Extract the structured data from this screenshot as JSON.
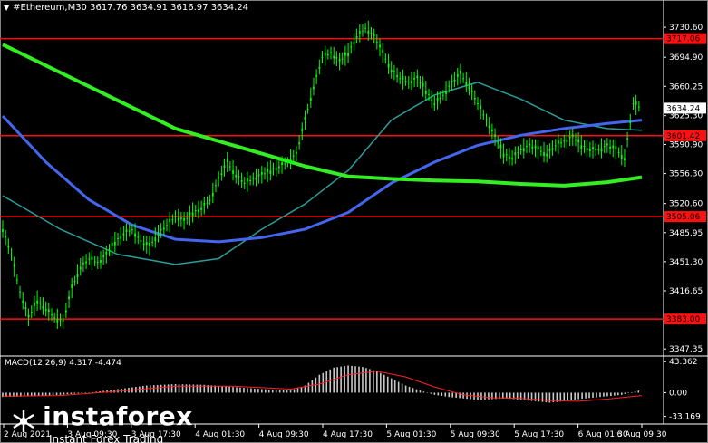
{
  "header": {
    "symbol_line": "#Ethereum,M30  3617.76 3634.91 3616.97 3634.24"
  },
  "macd": {
    "label": "MACD(12,26,9) 4.317 -4.474"
  },
  "logo": {
    "name": "instaforex",
    "tagline": "Instant Forex Trading"
  },
  "colors": {
    "background": "#000000",
    "candle": "#00ff00",
    "ma_fast": "#2a9d9a",
    "ma_mid": "#4466ee",
    "ma_slow": "#33ee22",
    "level_line": "#ff1010",
    "macd_hist": "#c8c8c8",
    "macd_signal": "#ff2020",
    "axis": "#ffffff"
  },
  "chart_data": {
    "type": "candlestick",
    "symbol": "#Ethereum",
    "timeframe": "M30",
    "ylim": [
      3340,
      3748
    ],
    "price_ticks": [
      "3730.60",
      "3694.90",
      "3660.25",
      "3625.30",
      "3590.90",
      "3556.30",
      "3520.60",
      "3485.95",
      "3451.30",
      "3416.65",
      "3381.00",
      "3347.35"
    ],
    "levels": [
      {
        "value": "3717.06"
      },
      {
        "value": "3601.42"
      },
      {
        "value": "3505.06"
      },
      {
        "value": "3383.00"
      }
    ],
    "current_price": "3634.24",
    "x_labels": [
      "2 Aug 2021",
      "3 Aug 09:30",
      "3 Aug 17:30",
      "4 Aug 01:30",
      "4 Aug 09:30",
      "4 Aug 17:30",
      "5 Aug 01:30",
      "5 Aug 09:30",
      "5 Aug 17:30",
      "6 Aug 01:30",
      "6 Aug 09:30"
    ],
    "close_path": [
      [
        0,
        3490
      ],
      [
        6,
        3460
      ],
      [
        12,
        3415
      ],
      [
        18,
        3385
      ],
      [
        24,
        3405
      ],
      [
        30,
        3395
      ],
      [
        36,
        3385
      ],
      [
        42,
        3380
      ],
      [
        48,
        3420
      ],
      [
        54,
        3445
      ],
      [
        60,
        3455
      ],
      [
        66,
        3450
      ],
      [
        72,
        3460
      ],
      [
        78,
        3475
      ],
      [
        84,
        3485
      ],
      [
        90,
        3490
      ],
      [
        96,
        3475
      ],
      [
        102,
        3470
      ],
      [
        108,
        3485
      ],
      [
        114,
        3495
      ],
      [
        120,
        3505
      ],
      [
        126,
        3500
      ],
      [
        132,
        3510
      ],
      [
        138,
        3515
      ],
      [
        144,
        3525
      ],
      [
        150,
        3550
      ],
      [
        156,
        3570
      ],
      [
        162,
        3555
      ],
      [
        168,
        3545
      ],
      [
        174,
        3550
      ],
      [
        180,
        3555
      ],
      [
        186,
        3560
      ],
      [
        192,
        3565
      ],
      [
        198,
        3570
      ],
      [
        204,
        3580
      ],
      [
        210,
        3620
      ],
      [
        216,
        3660
      ],
      [
        222,
        3695
      ],
      [
        228,
        3700
      ],
      [
        234,
        3690
      ],
      [
        240,
        3700
      ],
      [
        246,
        3720
      ],
      [
        252,
        3730
      ],
      [
        258,
        3720
      ],
      [
        264,
        3700
      ],
      [
        270,
        3680
      ],
      [
        276,
        3670
      ],
      [
        282,
        3665
      ],
      [
        288,
        3670
      ],
      [
        294,
        3655
      ],
      [
        300,
        3640
      ],
      [
        306,
        3650
      ],
      [
        312,
        3665
      ],
      [
        318,
        3675
      ],
      [
        324,
        3660
      ],
      [
        330,
        3640
      ],
      [
        336,
        3620
      ],
      [
        342,
        3600
      ],
      [
        348,
        3580
      ],
      [
        354,
        3575
      ],
      [
        360,
        3585
      ],
      [
        366,
        3590
      ],
      [
        372,
        3585
      ],
      [
        378,
        3580
      ],
      [
        384,
        3590
      ],
      [
        390,
        3595
      ],
      [
        396,
        3600
      ],
      [
        402,
        3590
      ],
      [
        408,
        3585
      ],
      [
        414,
        3585
      ],
      [
        420,
        3590
      ],
      [
        426,
        3585
      ],
      [
        432,
        3575
      ],
      [
        438,
        3640
      ],
      [
        444,
        3634.24
      ]
    ],
    "ma_fast": [
      [
        0,
        3530
      ],
      [
        40,
        3490
      ],
      [
        80,
        3460
      ],
      [
        120,
        3448
      ],
      [
        150,
        3455
      ],
      [
        180,
        3490
      ],
      [
        210,
        3520
      ],
      [
        240,
        3560
      ],
      [
        270,
        3620
      ],
      [
        300,
        3650
      ],
      [
        330,
        3665
      ],
      [
        360,
        3645
      ],
      [
        390,
        3620
      ],
      [
        420,
        3610
      ],
      [
        444,
        3608
      ]
    ],
    "ma_mid": [
      [
        0,
        3625
      ],
      [
        30,
        3570
      ],
      [
        60,
        3525
      ],
      [
        90,
        3495
      ],
      [
        120,
        3478
      ],
      [
        150,
        3475
      ],
      [
        180,
        3480
      ],
      [
        210,
        3490
      ],
      [
        240,
        3510
      ],
      [
        270,
        3545
      ],
      [
        300,
        3570
      ],
      [
        330,
        3590
      ],
      [
        360,
        3602
      ],
      [
        390,
        3610
      ],
      [
        420,
        3616
      ],
      [
        444,
        3620
      ]
    ],
    "ma_slow": [
      [
        0,
        3710
      ],
      [
        60,
        3660
      ],
      [
        120,
        3610
      ],
      [
        180,
        3580
      ],
      [
        210,
        3565
      ],
      [
        240,
        3553
      ],
      [
        270,
        3550
      ],
      [
        300,
        3548
      ],
      [
        330,
        3547
      ],
      [
        360,
        3544
      ],
      [
        390,
        3542
      ],
      [
        420,
        3546
      ],
      [
        444,
        3552
      ]
    ],
    "macd_ylim": [
      -40,
      50
    ],
    "macd_ticks": [
      "43.362",
      "0.00",
      "-33.169"
    ],
    "macd_hist": [
      [
        0,
        -6
      ],
      [
        20,
        -5
      ],
      [
        40,
        -3
      ],
      [
        60,
        0
      ],
      [
        80,
        5
      ],
      [
        100,
        10
      ],
      [
        120,
        12
      ],
      [
        140,
        11
      ],
      [
        160,
        8
      ],
      [
        180,
        5
      ],
      [
        200,
        3
      ],
      [
        210,
        10
      ],
      [
        220,
        25
      ],
      [
        230,
        35
      ],
      [
        240,
        38
      ],
      [
        250,
        36
      ],
      [
        260,
        30
      ],
      [
        270,
        20
      ],
      [
        280,
        10
      ],
      [
        290,
        3
      ],
      [
        300,
        -3
      ],
      [
        310,
        -6
      ],
      [
        320,
        -8
      ],
      [
        330,
        -10
      ],
      [
        340,
        -9
      ],
      [
        350,
        -8
      ],
      [
        360,
        -10
      ],
      [
        370,
        -12
      ],
      [
        380,
        -14
      ],
      [
        390,
        -12
      ],
      [
        400,
        -9
      ],
      [
        410,
        -7
      ],
      [
        420,
        -5
      ],
      [
        430,
        -3
      ],
      [
        444,
        4
      ]
    ],
    "macd_signal": [
      [
        0,
        -5
      ],
      [
        40,
        -4
      ],
      [
        80,
        2
      ],
      [
        120,
        9
      ],
      [
        160,
        9
      ],
      [
        200,
        5
      ],
      [
        220,
        12
      ],
      [
        240,
        25
      ],
      [
        260,
        30
      ],
      [
        280,
        22
      ],
      [
        300,
        8
      ],
      [
        320,
        -3
      ],
      [
        340,
        -7
      ],
      [
        360,
        -8
      ],
      [
        380,
        -11
      ],
      [
        400,
        -12
      ],
      [
        420,
        -9
      ],
      [
        444,
        -4
      ]
    ]
  }
}
